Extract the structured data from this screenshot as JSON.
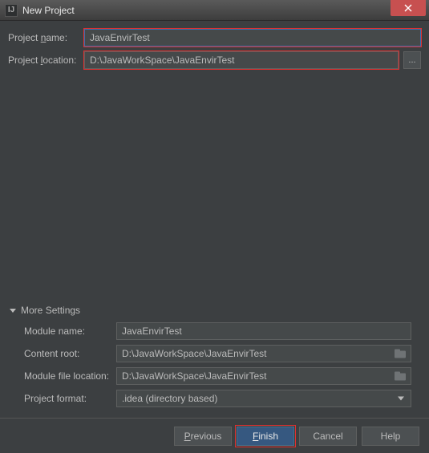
{
  "window": {
    "title": "New Project",
    "icon_letter": "IJ"
  },
  "fields": {
    "project_name_label_pre": "Project ",
    "project_name_label_u": "n",
    "project_name_label_post": "ame:",
    "project_name_value": "JavaEnvirTest",
    "project_location_label_pre": "Project ",
    "project_location_label_u": "l",
    "project_location_label_post": "ocation:",
    "project_location_value": "D:\\JavaWorkSpace\\JavaEnvirTest",
    "browse_label": "..."
  },
  "more": {
    "header_pre": "Mor",
    "header_u": "e",
    "header_post": " Settings",
    "module_name_label": "Module name:",
    "module_name_value": "JavaEnvirTest",
    "content_root_label": "Content root:",
    "content_root_value": "D:\\JavaWorkSpace\\JavaEnvirTest",
    "module_file_label": "Module file location:",
    "module_file_value": "D:\\JavaWorkSpace\\JavaEnvirTest",
    "project_format_label": "Project format:",
    "project_format_value": ".idea (directory based)"
  },
  "buttons": {
    "previous_u": "P",
    "previous_rest": "revious",
    "finish_u": "F",
    "finish_rest": "inish",
    "cancel": "Cancel",
    "help": "Help"
  }
}
